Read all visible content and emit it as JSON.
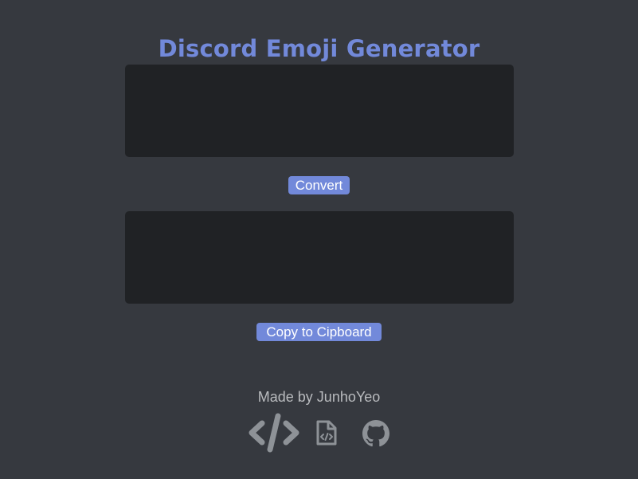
{
  "header": {
    "title": "Discord Emoji Generator"
  },
  "converter": {
    "input_value": "",
    "input_placeholder": "",
    "convert_label": "Convert",
    "output_value": "",
    "output_placeholder": "",
    "copy_label": "Copy to Cipboard"
  },
  "footer": {
    "credit": "Made by JunhoYeo",
    "links": [
      {
        "icon": "code-icon"
      },
      {
        "icon": "file-code-icon"
      },
      {
        "icon": "github-icon"
      }
    ]
  },
  "colors": {
    "background": "#36393f",
    "accent": "#7289da",
    "textbox": "#202225",
    "muted_text": "#b9bbbe",
    "icon": "#8e9297"
  }
}
